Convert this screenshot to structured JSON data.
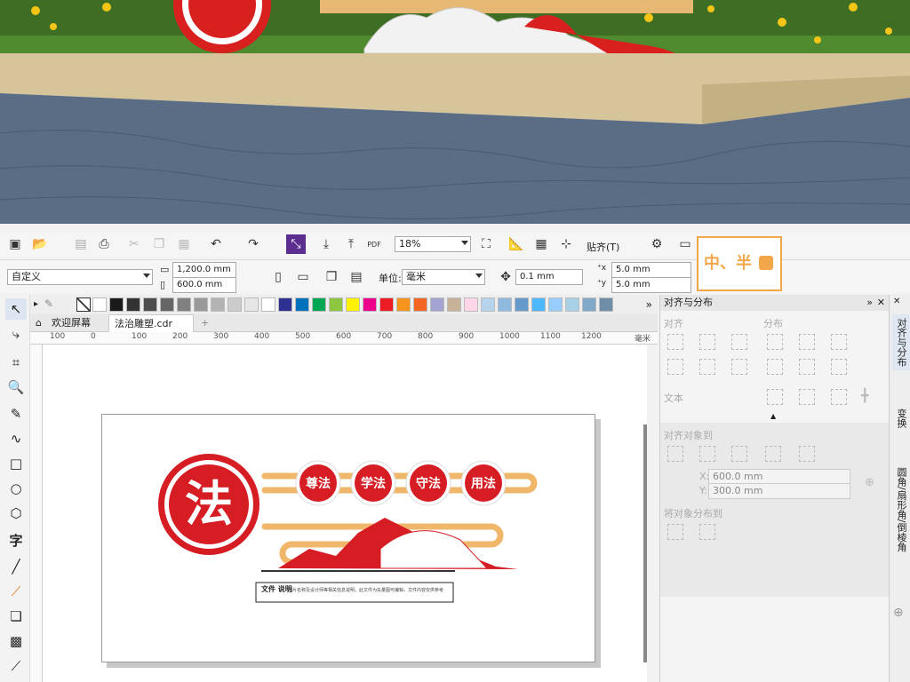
{
  "photo": {
    "description_icon": "3d-scene-photo"
  },
  "toolbar1": {
    "zoom": "18%",
    "pdf_label": "PDF",
    "snap_label": "贴齐(T)"
  },
  "toolbar2": {
    "preset": "自定义",
    "width": "1,200.0 mm",
    "height": "600.0 mm",
    "unit_label": "单位:",
    "unit": "毫米",
    "nudge": "0.1 mm",
    "dup_x": "5.0 mm",
    "dup_y": "5.0 mm"
  },
  "logo": {
    "text": "中、半"
  },
  "tabs": [
    {
      "label": "欢迎屏幕"
    },
    {
      "label": "法治雕塑.cdr"
    }
  ],
  "ruler": {
    "ticks": [
      "100",
      "0",
      "100",
      "200",
      "300",
      "400",
      "500",
      "600",
      "700",
      "800",
      "900",
      "1000",
      "1100",
      "1200"
    ],
    "unit": "毫米"
  },
  "palette": {
    "colors": [
      "#ffffff",
      "#1a1a1a",
      "#333333",
      "#4d4d4d",
      "#666666",
      "#808080",
      "#999999",
      "#b3b3b3",
      "#cccccc",
      "#e6e6e6",
      "#ffffff",
      "#2e3192",
      "#0072bc",
      "#00a651",
      "#8dc63f",
      "#fff200",
      "#ec008c",
      "#ed1c24",
      "#f7941d",
      "#f26522",
      "#a3a3d1",
      "#c7b299",
      "#ffd6e7",
      "#b5d3ea",
      "#8fb9df",
      "#6699cc",
      "#4db8ff",
      "#99ccff",
      "#a8d0e6",
      "#7fa8c9",
      "#6e8ea8"
    ]
  },
  "panel": {
    "title": "对齐与分布",
    "align": "对齐",
    "distribute": "分布",
    "text": "文本",
    "align_objects": "对齐对象到",
    "x": "600.0 mm",
    "y": "300.0 mm",
    "distribute_objects": "将对象分布到"
  },
  "sidetabs": [
    {
      "label": "对齐与分布"
    },
    {
      "label": "变换"
    },
    {
      "label": "圆角/扇形角/倒棱角"
    }
  ],
  "artwork": {
    "big_char": "法",
    "circles": [
      "尊法",
      "学法",
      "守法",
      "用法"
    ],
    "note_title": "文件\n说明",
    "note_text": "图片名称及设计师等相关信息说明，此文件为矢量图可编辑，文件内容仅供参考"
  }
}
